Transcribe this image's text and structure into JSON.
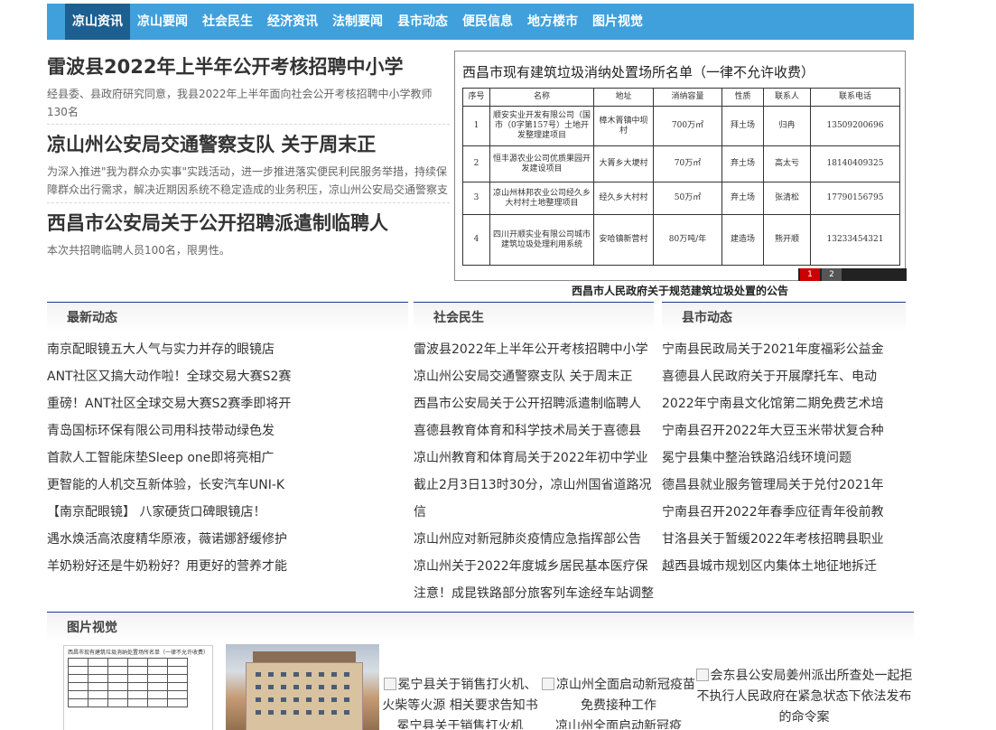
{
  "nav": [
    "凉山资讯",
    "凉山要闻",
    "社会民生",
    "经济资讯",
    "法制要闻",
    "县市动态",
    "便民信息",
    "地方楼市",
    "图片视觉"
  ],
  "headlines": [
    {
      "title": "雷波县2022年上半年公开考核招聘中小学",
      "summary": "经县委、县政府研究同意，我县2022年上半年面向社会公开考核招聘中小学教师130名"
    },
    {
      "title": "凉山州公安局交通警察支队 关于周末正",
      "summary": "为深入推进\"我为群众办实事\"实践活动，进一步推进落实便民利民服务举措，持续保障群众出行需求，解决近期因系统不稳定造成的业务积压，凉山州公安局交通警察支队将"
    },
    {
      "title": "西昌市公安局关于公开招聘派遣制临聘人",
      "summary": "本次共招聘临聘人员100名，限男性。"
    }
  ],
  "slide": {
    "doc_title": "西昌市现有建筑垃圾消纳处置场所名单（一律不允许收费）",
    "headers": [
      "序号",
      "名称",
      "地址",
      "消纳容量",
      "性质",
      "联系人",
      "联系电话"
    ],
    "rows": [
      [
        "1",
        "顺安实业开发有限公司（国市（0字第157号）土地开发整理建项目",
        "樟木箐镇中坝村",
        "700万㎡",
        "拜土场",
        "归冉",
        "13509200696"
      ],
      [
        "2",
        "恒丰源农业公司优质果园开发建设项目",
        "大箐乡大埂村",
        "70万㎡",
        "弃土场",
        "高太亏",
        "18140409325"
      ],
      [
        "3",
        "凉山州林邦农业公司经久乡大村村土地整理项目",
        "经久乡大村村",
        "50万㎡",
        "弃土场",
        "张清松",
        "17790156795"
      ],
      [
        "4",
        "四川开顺实业有限公司城市建筑垃圾处理利用系统",
        "安哈镇新营村",
        "80万吨/年",
        "建造场",
        "熊开顺",
        "13233454321"
      ]
    ],
    "pages": [
      "1",
      "2"
    ],
    "caption": "西昌市人民政府关于规范建筑垃圾处置的公告"
  },
  "latest": {
    "title": "最新动态",
    "items": [
      "南京配眼镜五大人气与实力并存的眼镜店",
      "ANT社区又搞大动作啦！全球交易大赛S2赛",
      "重磅！ANT社区全球交易大赛S2赛季即将开",
      "青岛国标环保有限公司用科技带动绿色发",
      "首款人工智能床垫Sleep one即将亮相广",
      "更智能的人机交互新体验，长安汽车UNI-K",
      "【南京配眼镜】 八家硬货口碑眼镜店！",
      "遇水焕活高浓度精华原液，薇诺娜舒缓修护",
      "羊奶粉好还是牛奶粉好？用更好的营养才能"
    ]
  },
  "social": {
    "title": "社会民生",
    "items": [
      "雷波县2022年上半年公开考核招聘中小学",
      "凉山州公安局交通警察支队 关于周末正",
      "西昌市公安局关于公开招聘派遣制临聘人",
      "喜德县教育体育和科学技术局关于喜德县",
      "凉山州教育和体育局关于2022年初中学业",
      "截止2月3日13时30分，凉山州国省道路况信",
      "凉山州应对新冠肺炎疫情应急指挥部公告",
      "凉山州关于2022年度城乡居民基本医疗保",
      "注意！成昆铁路部分旅客列车途经车站调整"
    ]
  },
  "county": {
    "title": "县市动态",
    "items": [
      "宁南县民政局关于2021年度福彩公益金",
      "喜德县人民政府关于开展摩托车、电动",
      "2022年宁南县文化馆第二期免费艺术培",
      "宁南县召开2022年大豆玉米带状复合种",
      "冕宁县集中整治铁路沿线环境问题",
      "德昌县就业服务管理局关于兑付2021年",
      "宁南县召开2022年春季应征青年役前教",
      "甘洛县关于暂缓2022年考核招聘县职业",
      "越西县城市规划区内集体土地征地拆迁"
    ]
  },
  "pictures": {
    "title": "图片视觉",
    "items": [
      {
        "alt": "冕宁县关于销售打火机、火柴等火源 相关要求告知书",
        "caption": "冕宁县关于销售打火机"
      },
      {
        "alt": "凉山州全面启动新冠疫苗免费接种工作",
        "caption": "凉山州全面启动新冠疫"
      },
      {
        "alt": "会东县公安局姜州派出所查处一起拒不执行人民政府在紧急状态下依法发布的命令案",
        "caption": ""
      }
    ]
  }
}
